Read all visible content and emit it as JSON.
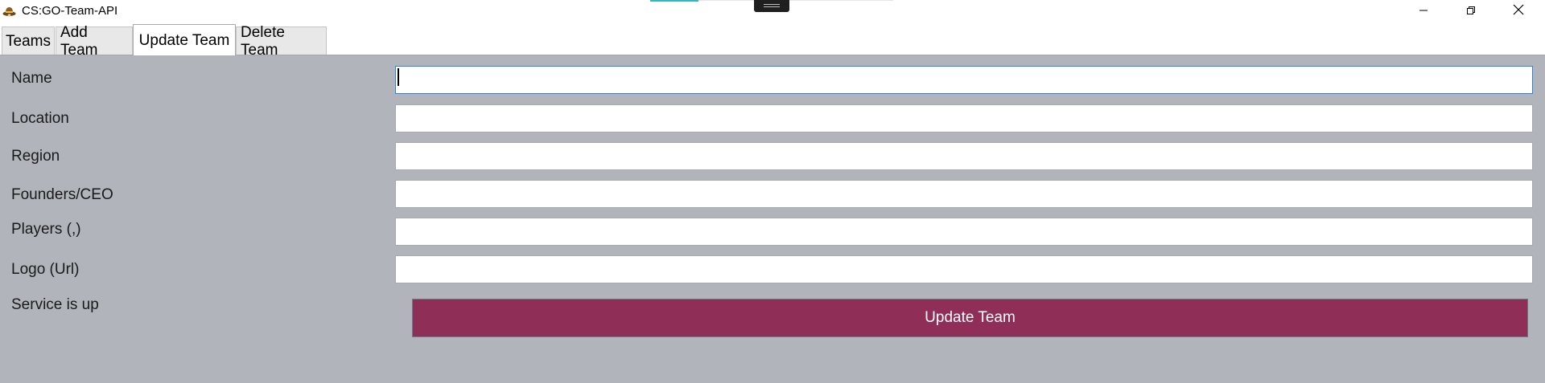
{
  "window": {
    "title": "CS:GO-Team-API",
    "icon": "cowboy-hat-icon"
  },
  "controls": {
    "minimize_icon": "minimize-icon",
    "maximize_icon": "restore-icon",
    "close_icon": "close-icon"
  },
  "tabs": [
    {
      "label": "Teams",
      "active": false
    },
    {
      "label": "Add Team",
      "active": false
    },
    {
      "label": "Update Team",
      "active": true
    },
    {
      "label": "Delete Team",
      "active": false
    }
  ],
  "form": {
    "fields": [
      {
        "label": "Name",
        "value": ""
      },
      {
        "label": "Location",
        "value": ""
      },
      {
        "label": "Region",
        "value": ""
      },
      {
        "label": "Founders/CEO",
        "value": ""
      },
      {
        "label": "Players (,)",
        "value": ""
      },
      {
        "label": "Logo (Url)",
        "value": ""
      }
    ],
    "status": "Service is up",
    "submit_label": "Update Team"
  },
  "colors": {
    "panel_background": "#b1b4bb",
    "button_background": "#8f2e56",
    "focus_border": "#2f84d6",
    "top_accent": "#39b5bf"
  }
}
